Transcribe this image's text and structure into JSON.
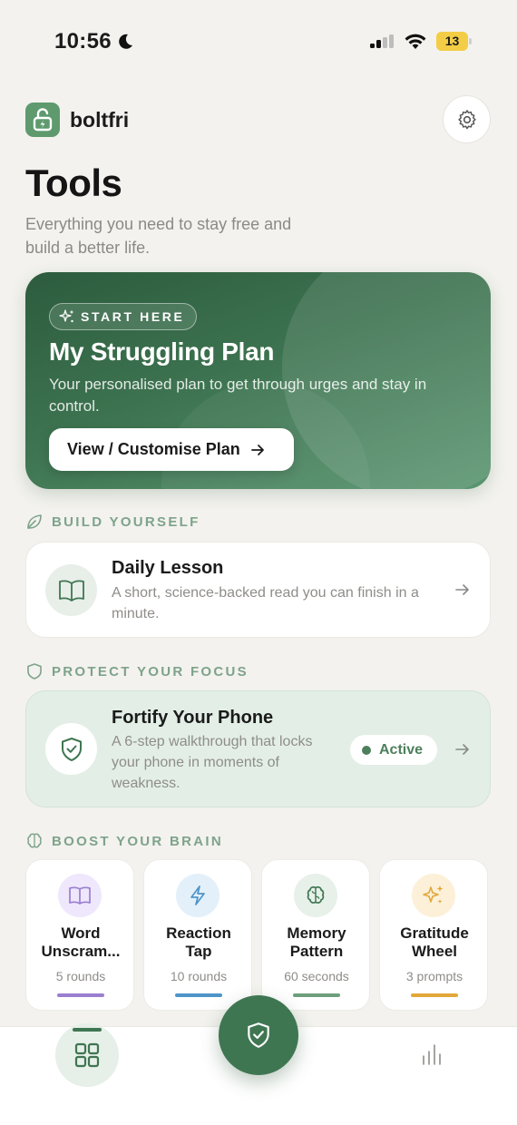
{
  "status_bar": {
    "time": "10:56",
    "battery_level": "13",
    "icons": [
      "moon-icon",
      "signal-icon",
      "wifi-icon",
      "battery-icon"
    ]
  },
  "header": {
    "brand_name": "boltfri",
    "title": "Tools",
    "subtitle": "Everything you need to stay free and build a better life."
  },
  "hero": {
    "badge": "START HERE",
    "title": "My Struggling Plan",
    "description": "Your personalised plan to get through urges and stay in control.",
    "button_label": "View / Customise Plan"
  },
  "sections": {
    "build": "BUILD YOURSELF",
    "protect": "PROTECT YOUR FOCUS",
    "boost": "BOOST YOUR BRAIN"
  },
  "lesson": {
    "title": "Daily Lesson",
    "description": "A short, science-backed read you can finish in a minute."
  },
  "fortify": {
    "title": "Fortify Your Phone",
    "description": "A 6-step walkthrough that locks your phone in moments of weakness.",
    "status": "Active"
  },
  "games": [
    {
      "name": "Word\nUnscram...",
      "meta": "5 rounds",
      "icon": "book-icon",
      "color": "#9a7fd1",
      "bg": "#efe7fb"
    },
    {
      "name": "Reaction\nTap",
      "meta": "10 rounds",
      "icon": "bolt-icon",
      "color": "#4e95c8",
      "bg": "#e3f0fa"
    },
    {
      "name": "Memory\nPattern",
      "meta": "60 seconds",
      "icon": "brain-icon",
      "color": "#6e9e7c",
      "bg": "#e7f0e9"
    },
    {
      "name": "Gratitude\nWheel",
      "meta": "3 prompts",
      "icon": "sparkles-icon",
      "color": "#e2a73a",
      "bg": "#fcf0d8"
    }
  ],
  "tab_bar": {
    "items": [
      "grid-icon",
      "shield-check-icon",
      "bar-chart-icon"
    ]
  },
  "colors": {
    "accent": "#3f7652",
    "background": "#f3f2ee",
    "section_label": "#7ea38a"
  }
}
